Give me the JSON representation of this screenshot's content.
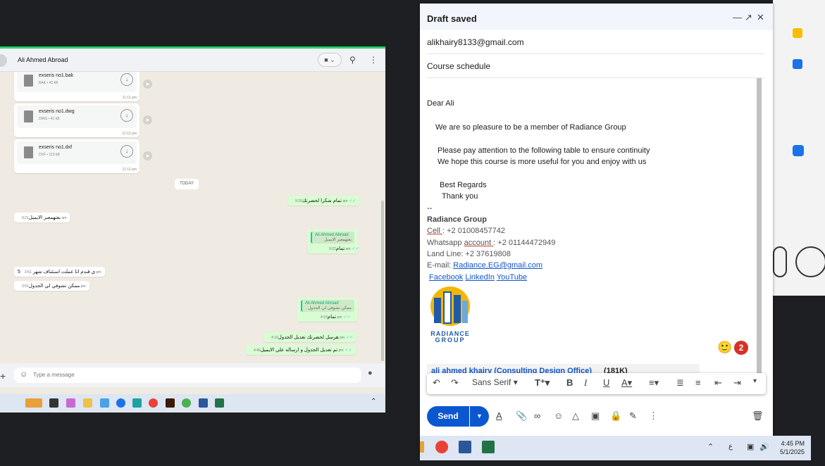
{
  "whatsapp": {
    "contact_name": "Ali Ahmed Abroad",
    "files": [
      {
        "name": "exseris no1.bak",
        "meta": "BAK • 42 kB",
        "time": "11:12 pm"
      },
      {
        "name": "exseris no1.dwg",
        "meta": "DWG • 41 kB",
        "time": "11:12 pm"
      },
      {
        "name": "exseris no1.dxf",
        "meta": "DXF • 113 kB",
        "time": "11:12 pm"
      }
    ],
    "today_label": "TODAY",
    "messages": [
      {
        "dir": "out",
        "text": "تمام شكرا لحضرتك",
        "time": "9:20 am"
      },
      {
        "dir": "in",
        "text": "بعتهمعبر الايميل",
        "time": "9:21 am"
      },
      {
        "dir": "out",
        "quote_name": "Ali Ahmed Abroad",
        "quote_text": "بعتهمعبر الايميل",
        "text": "تمام",
        "time": "9:22 am"
      },
      {
        "dir": "in",
        "text": "ي قندم انا عملت استئناف شهر 5",
        "time": "3:51 pm"
      },
      {
        "dir": "in",
        "text": "ممكن تشوفي لي الجدول",
        "time": "3:51 pm"
      },
      {
        "dir": "out",
        "quote_name": "Ali Ahmed Abroad",
        "quote_text": "ممكن تشوفي لي الجدول",
        "text": "تمام",
        "time": "4:19 pm"
      },
      {
        "dir": "out",
        "text": "هرسل لحضرتك تعديل الجدول",
        "time": "4:19 pm"
      },
      {
        "dir": "out",
        "text": "تم تعديل الجدول و ارساله علي الايميل",
        "time": "4:46 pm"
      }
    ],
    "input_placeholder": "Type a message"
  },
  "compose": {
    "title": "Draft saved",
    "to": "alikhairy8133@gmail.com",
    "subject": "Course schedule",
    "body": {
      "greeting": "Dear Ali",
      "line1": "We are so pleasure to be a member of Radiance Group",
      "line2": "Please pay attention to the following table to ensure continuity",
      "line3": "We hope this course is more useful for you and enjoy with us",
      "regards": "Best Regards",
      "thanks": "Thank you",
      "sep": "--",
      "org": "Radiance Group",
      "cell_label": "Cell ",
      "cell_value": ": +2 01008457742",
      "whatsapp_label": "Whatsapp ",
      "whatsapp_acc": "account ",
      "whatsapp_value": ": +2 01144472949",
      "landline": "Land Line: +2 37619808",
      "email_label": "E-mail: ",
      "email_value": "Radiance.EG@gmail.com",
      "link_facebook": "Facebook",
      "link_linkedin": "LinkedIn",
      "link_youtube": "YouTube ",
      "logo_text_1": "RADIANCE",
      "logo_text_2": "GROUP"
    },
    "attachment": {
      "name": "ali ahmed khairy (Consulting Design Office)",
      "size": "(181K)"
    },
    "badge_count": "2",
    "format_font": "Sans Serif",
    "send_label": "Send"
  },
  "taskbar": {
    "time": "4:45 PM",
    "date": "5/1/2025",
    "lang": "ع"
  },
  "colors": {
    "accent": "#0b57d0",
    "whatsapp_green": "#25d366",
    "out_bubble": "#d9fdd3"
  }
}
